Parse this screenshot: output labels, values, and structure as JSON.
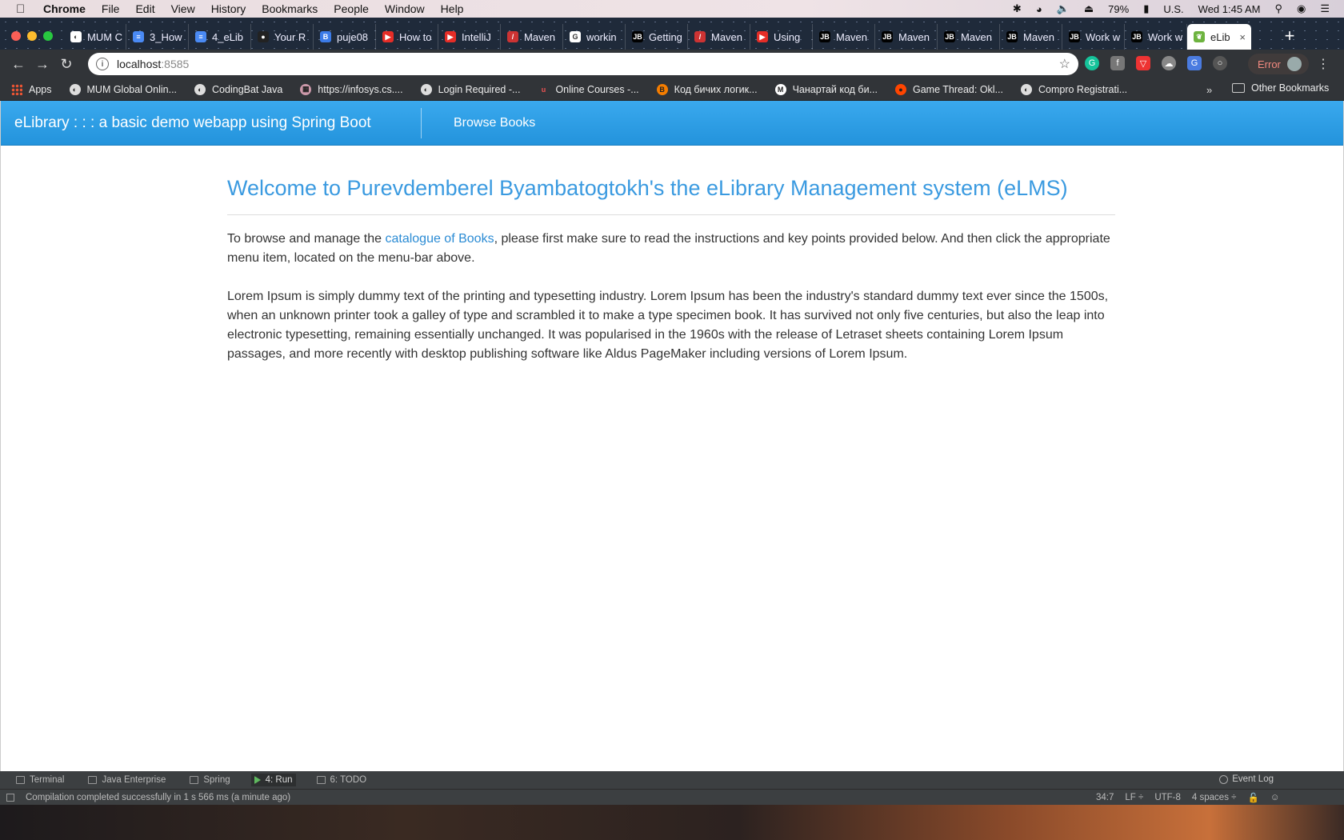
{
  "menubar": {
    "app": "Chrome",
    "items": [
      "File",
      "Edit",
      "View",
      "History",
      "Bookmarks",
      "People",
      "Window",
      "Help"
    ],
    "battery": "79%",
    "input_source": "U.S.",
    "clock": "Wed 1:45 AM"
  },
  "tabs": [
    {
      "label": "MUM C",
      "icon": "globe-icon",
      "color": "#ffffff"
    },
    {
      "label": "3_How",
      "icon": "docs-icon",
      "color": "#4a8af4"
    },
    {
      "label": "4_eLib",
      "icon": "docs-icon",
      "color": "#4a8af4"
    },
    {
      "label": "Your R",
      "icon": "github-icon",
      "color": "#222222"
    },
    {
      "label": "puje08",
      "icon": "bookmark-icon",
      "color": "#3b7be8"
    },
    {
      "label": "How to",
      "icon": "youtube-icon",
      "color": "#e52d27"
    },
    {
      "label": "IntelliJ",
      "icon": "youtube-icon",
      "color": "#e52d27"
    },
    {
      "label": "Maven",
      "icon": "maven-icon",
      "color": "#c33"
    },
    {
      "label": "workin",
      "icon": "google-icon",
      "color": "#ffffff"
    },
    {
      "label": "Getting",
      "icon": "jetbrains-icon",
      "color": "#000000"
    },
    {
      "label": "Maven",
      "icon": "maven-icon",
      "color": "#c33"
    },
    {
      "label": "Using",
      "icon": "youtube-icon",
      "color": "#e52d27"
    },
    {
      "label": "Maven",
      "icon": "jetbrains-icon",
      "color": "#000000"
    },
    {
      "label": "Maven",
      "icon": "jetbrains-icon",
      "color": "#000000"
    },
    {
      "label": "Maven",
      "icon": "jetbrains-icon",
      "color": "#000000"
    },
    {
      "label": "Maven",
      "icon": "jetbrains-icon",
      "color": "#000000"
    },
    {
      "label": "Work w",
      "icon": "jetbrains-icon",
      "color": "#000000"
    },
    {
      "label": "Work w",
      "icon": "jetbrains-icon",
      "color": "#000000"
    },
    {
      "label": "eLib",
      "icon": "spring-leaf-icon",
      "color": "#6db33f",
      "active": true
    }
  ],
  "address": {
    "host": "localhost",
    "port": ":8585"
  },
  "error_button": "Error",
  "bookmarks": [
    {
      "label": "Apps",
      "icon": "apps-grid-icon"
    },
    {
      "label": "MUM Global Onlin...",
      "icon": "globe-icon"
    },
    {
      "label": "CodingBat Java",
      "icon": "globe-icon"
    },
    {
      "label": "https://infosys.cs....",
      "icon": "image-icon"
    },
    {
      "label": "Login Required -...",
      "icon": "globe-icon"
    },
    {
      "label": "Online Courses -...",
      "icon": "udemy-icon"
    },
    {
      "label": "Код бичих логик...",
      "icon": "blogger-icon"
    },
    {
      "label": "Чанартай код би...",
      "icon": "medium-icon"
    },
    {
      "label": "Game Thread: Okl...",
      "icon": "reddit-icon"
    },
    {
      "label": "Compro Registrati...",
      "icon": "globe-icon"
    }
  ],
  "bookmarks_more": "»",
  "other_bookmarks": "Other Bookmarks",
  "site": {
    "brand": "eLibrary : : : a basic demo webapp using Spring Boot",
    "nav_browse": "Browse Books",
    "heading": "Welcome to Purevdemberel Byambatogtokh's the eLibrary Management system (eLMS)",
    "intro_before": "To browse and manage the ",
    "intro_link": "catalogue of Books",
    "intro_after": ", please first make sure to read the instructions and key points provided below. And then click the appropriate menu item, located on the menu-bar above.",
    "lorem": "Lorem Ipsum is simply dummy text of the printing and typesetting industry. Lorem Ipsum has been the industry's standard dummy text ever since the 1500s, when an unknown printer took a galley of type and scrambled it to make a type specimen book. It has survived not only five centuries, but also the leap into electronic typesetting, remaining essentially unchanged. It was popularised in the 1960s with the release of Letraset sheets containing Lorem Ipsum passages, and more recently with desktop publishing software like Aldus PageMaker including versions of Lorem Ipsum."
  },
  "ide": {
    "tools": [
      "Terminal",
      "Java Enterprise",
      "Spring",
      "4: Run",
      "6: TODO"
    ],
    "event_log": "Event Log",
    "status_message": "Compilation completed successfully in 1 s 566 ms (a minute ago)",
    "cursor": "34:7",
    "line_sep": "LF ÷",
    "encoding": "UTF-8",
    "indent": "4 spaces ÷"
  },
  "colors": {
    "navbar": "#2c9ee6",
    "heading": "#3a9ae0",
    "link": "#2a8bd4"
  }
}
